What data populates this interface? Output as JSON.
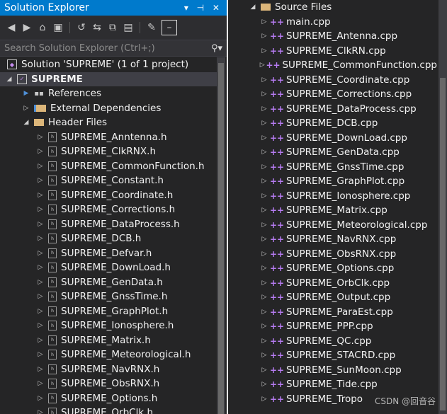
{
  "left": {
    "title": "Solution Explorer",
    "title_buttons": "▾ ⊣ ✕",
    "search_placeholder": "Search Solution Explorer (Ctrl+;)",
    "solution": "Solution 'SUPREME' (1 of 1 project)",
    "project": "SUPREME",
    "references": "References",
    "external": "External Dependencies",
    "headers_folder": "Header Files",
    "header_files": [
      "SUPREME_Anntenna.h",
      "SUPREME_ClkRNX.h",
      "SUPREME_CommonFunction.h",
      "SUPREME_Constant.h",
      "SUPREME_Coordinate.h",
      "SUPREME_Corrections.h",
      "SUPREME_DataProcess.h",
      "SUPREME_DCB.h",
      "SUPREME_Defvar.h",
      "SUPREME_DownLoad.h",
      "SUPREME_GenData.h",
      "SUPREME_GnssTime.h",
      "SUPREME_GraphPlot.h",
      "SUPREME_Ionosphere.h",
      "SUPREME_Matrix.h",
      "SUPREME_Meteorological.h",
      "SUPREME_NavRNX.h",
      "SUPREME_ObsRNX.h",
      "SUPREME_Options.h",
      "SUPREME_OrbClk.h"
    ]
  },
  "right": {
    "source_folder": "Source Files",
    "source_files": [
      "main.cpp",
      "SUPREME_Antenna.cpp",
      "SUPREME_ClkRN.cpp",
      "SUPREME_CommonFunction.cpp",
      "SUPREME_Coordinate.cpp",
      "SUPREME_Corrections.cpp",
      "SUPREME_DataProcess.cpp",
      "SUPREME_DCB.cpp",
      "SUPREME_DownLoad.cpp",
      "SUPREME_GenData.cpp",
      "SUPREME_GnssTime.cpp",
      "SUPREME_GraphPlot.cpp",
      "SUPREME_Ionosphere.cpp",
      "SUPREME_Matrix.cpp",
      "SUPREME_Meteorological.cpp",
      "SUPREME_NavRNX.cpp",
      "SUPREME_ObsRNX.cpp",
      "SUPREME_Options.cpp",
      "SUPREME_OrbClk.cpp",
      "SUPREME_Output.cpp",
      "SUPREME_ParaEst.cpp",
      "SUPREME_PPP.cpp",
      "SUPREME_QC.cpp",
      "SUPREME_STACRD.cpp",
      "SUPREME_SunMoon.cpp",
      "SUPREME_Tide.cpp",
      "SUPREME_Tropo"
    ],
    "watermark": "CSDN @回音谷"
  },
  "icons": [
    "back-icon",
    "forward-icon",
    "home-icon",
    "vs-icon",
    "history-icon",
    "sync-icon",
    "collapse-icon",
    "show-all-icon",
    "wrench-icon",
    "preview-icon"
  ],
  "colors": {
    "accent": "#007acc",
    "background": "#252526",
    "cpp_icon": "#b77cf2"
  }
}
